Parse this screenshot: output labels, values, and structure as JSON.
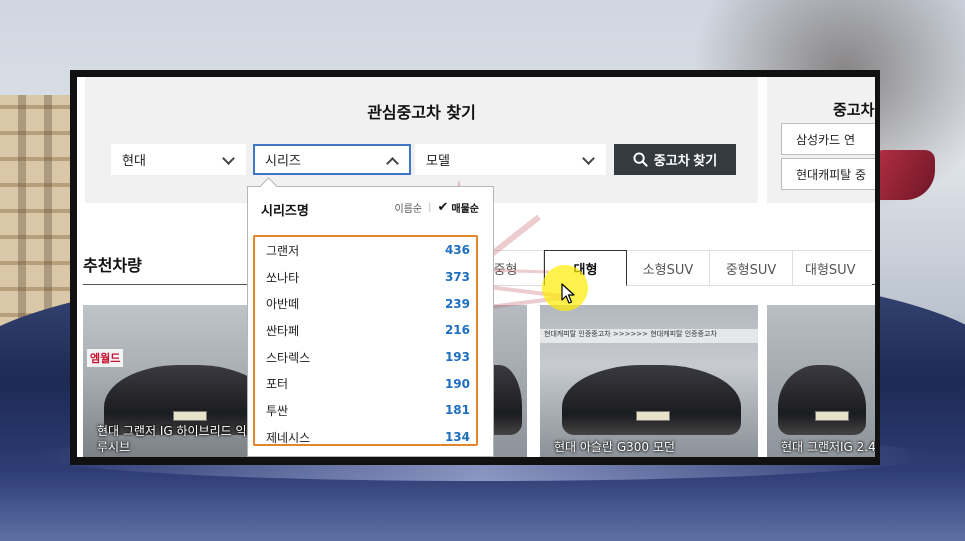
{
  "search": {
    "title": "관심중고차 찾기",
    "maker_value": "현대",
    "series_value": "시리즈",
    "model_value": "모델",
    "button_label": "중고차 찾기"
  },
  "side": {
    "title": "중고차",
    "buttons": [
      "삼성카드 연",
      "현대캐피탈 중"
    ]
  },
  "dropdown": {
    "header": "시리즈명",
    "sort_name": "이름순",
    "sort_count": "매물순",
    "items": [
      {
        "name": "그랜저",
        "count": "436"
      },
      {
        "name": "쏘나타",
        "count": "373"
      },
      {
        "name": "아반떼",
        "count": "239"
      },
      {
        "name": "싼타페",
        "count": "216"
      },
      {
        "name": "스타렉스",
        "count": "193"
      },
      {
        "name": "포터",
        "count": "190"
      },
      {
        "name": "투싼",
        "count": "181"
      },
      {
        "name": "제네시스",
        "count": "134"
      }
    ]
  },
  "recommend": {
    "title": "추천차량",
    "tabs": [
      "중형",
      "대형",
      "소형SUV",
      "중형SUV",
      "대형SUV"
    ],
    "active_tab": "대형",
    "cards": [
      {
        "caption_line1": "현대 그랜저 IG 하이브리드 익스클",
        "caption_line2": "루시브",
        "logo": "엠월드"
      },
      {
        "caption_line1": "",
        "caption_line2": ""
      },
      {
        "caption_line1": "현대 아슬란 G300 모던",
        "caption_line2": "",
        "banner": "현대캐피탈 인증중고차  >>>>>>  현대캐피탈 인증중고차"
      },
      {
        "caption_line1": "현대 그랜저IG 2.4",
        "caption_line2": ""
      }
    ]
  },
  "colors": {
    "accent_blue": "#3d77c6",
    "count_blue": "#1e6fc0",
    "highlight_orange": "#e1862c",
    "button_dark": "#333a40",
    "cursor_highlight": "#ffec00"
  }
}
